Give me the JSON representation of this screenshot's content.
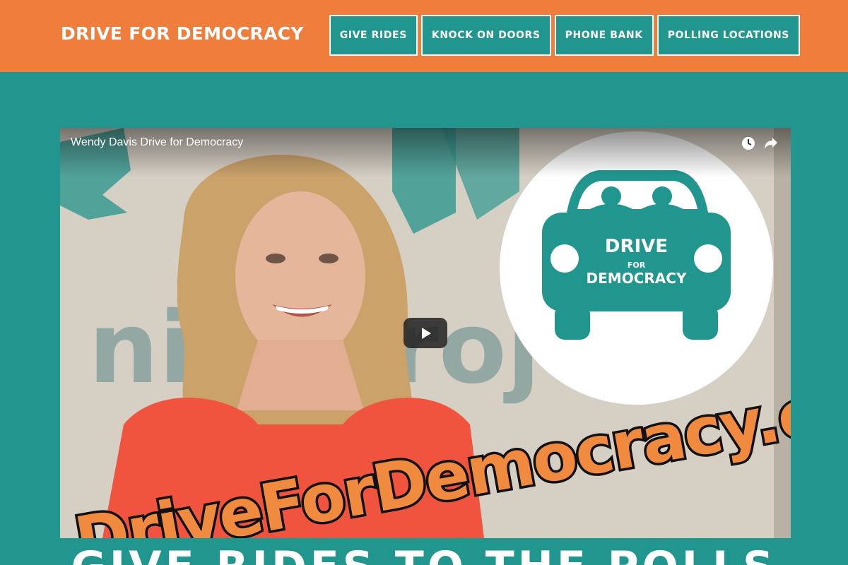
{
  "header": {
    "site_title": "DRIVE FOR DEMOCRACY",
    "nav": [
      {
        "label": "GIVE RIDES"
      },
      {
        "label": "KNOCK ON DOORS"
      },
      {
        "label": "PHONE BANK"
      },
      {
        "label": "POLLING LOCATIONS"
      }
    ]
  },
  "video": {
    "title": "Wendy Davis Drive for Democracy",
    "logo": {
      "line1": "DRIVE",
      "line2": "FOR",
      "line3": "DEMOCRACY"
    },
    "banner_text": "DriveForDemocracy.com",
    "background_wall_text": "nizeProject"
  },
  "section": {
    "heading": "GIVE RIDES TO THE POLLS"
  },
  "colors": {
    "header_bg": "#ef7d3c",
    "page_bg": "#20968f",
    "banner_orange": "#f08a3e"
  }
}
